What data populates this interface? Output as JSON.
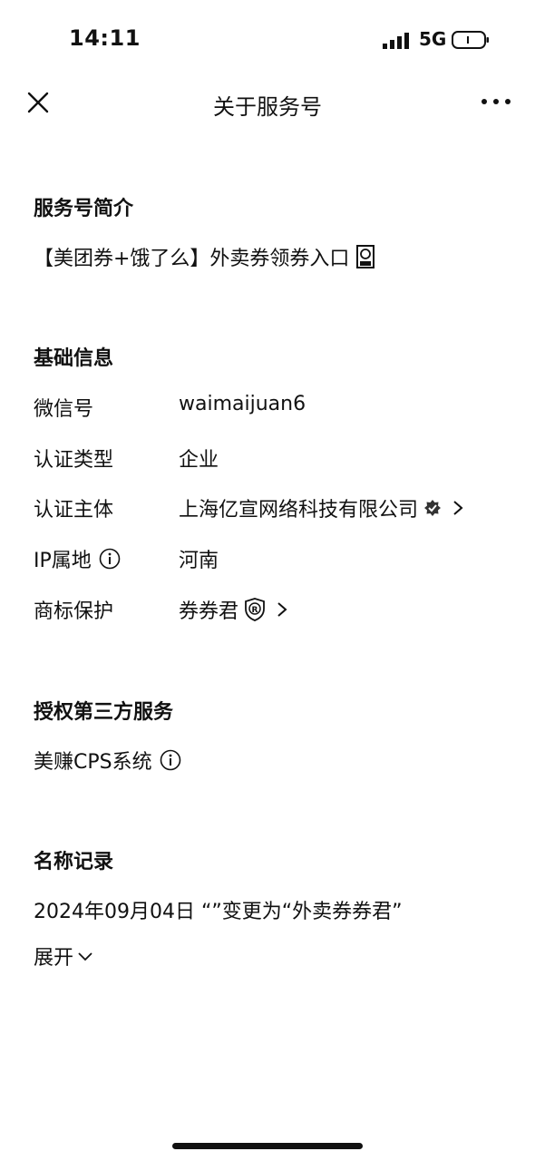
{
  "status_bar": {
    "time": "14:11",
    "network": "5G"
  },
  "nav": {
    "title": "关于服务号"
  },
  "intro": {
    "title": "服务号简介",
    "text": "【美团券+饿了么】外卖券领券入口",
    "emoji_icon": "ticket-emoji-icon"
  },
  "basic_info": {
    "title": "基础信息",
    "rows": [
      {
        "label": "微信号",
        "value": "waimaijuan6"
      },
      {
        "label": "认证类型",
        "value": "企业"
      },
      {
        "label": "认证主体",
        "value": "上海亿宣网络科技有限公司"
      },
      {
        "label": "IP属地",
        "value": "河南"
      },
      {
        "label": "商标保护",
        "value": "券券君"
      }
    ]
  },
  "third_party": {
    "title": "授权第三方服务",
    "item": "美赚CPS系统"
  },
  "name_history": {
    "title": "名称记录",
    "record": "2024年09月04日 “”变更为“外卖券券君”",
    "expand_label": "展开"
  }
}
